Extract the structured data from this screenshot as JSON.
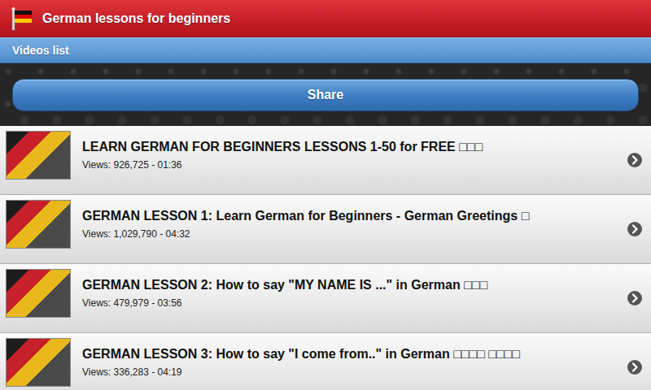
{
  "app": {
    "title": "German lessons for beginners"
  },
  "section": {
    "title": "Videos list"
  },
  "share_button": {
    "label": "Share"
  },
  "videos": [
    {
      "title": "LEARN GERMAN FOR BEGINNERS LESSONS 1-50 for FREE □□□",
      "meta": "Views: 926,725 - 01:36"
    },
    {
      "title": "GERMAN LESSON 1: Learn German for Beginners - German Greetings □",
      "meta": "Views: 1,029,790 - 04:32"
    },
    {
      "title": "GERMAN LESSON 2: How to say \"MY NAME IS ...\" in German □□□",
      "meta": "Views: 479,979 - 03:56"
    },
    {
      "title": "GERMAN LESSON 3: How to say \"I come from..\" in German □□□□ □□□□",
      "meta": "Views: 336,283 - 04:19"
    }
  ]
}
